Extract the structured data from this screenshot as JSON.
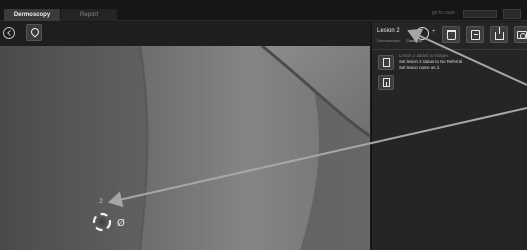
{
  "tabs": [
    {
      "label": "Dermoscopy",
      "active": true
    },
    {
      "label": "Report",
      "active": false
    }
  ],
  "top_meta": "go to case",
  "viewer": {
    "lesion_marker_number": "2",
    "lesion_marker_symbol": "Ø"
  },
  "panel": {
    "lesion_title": "Lesion 2",
    "lesion_sub_left": "Dermoscopic",
    "lesion_sub_right": "Close Up",
    "edit_plus": "+",
    "log_lines": [
      {
        "text": "Lesion 2 added to Images",
        "dim": true
      },
      {
        "text": "Set lesion 2 status to No Referral",
        "dim": false
      },
      {
        "text": "Set lesion name as 2.",
        "dim": false
      }
    ]
  },
  "colors": {
    "arrow": "#a0a0a0",
    "panel_bg": "#252525",
    "toolbar_bg": "#1e1e1e"
  },
  "icons": [
    "back-icon",
    "map-pin-icon",
    "edit-circle-icon",
    "trash-icon",
    "note-icon",
    "export-icon",
    "camera-icon",
    "add-image-icon",
    "import-icon"
  ]
}
